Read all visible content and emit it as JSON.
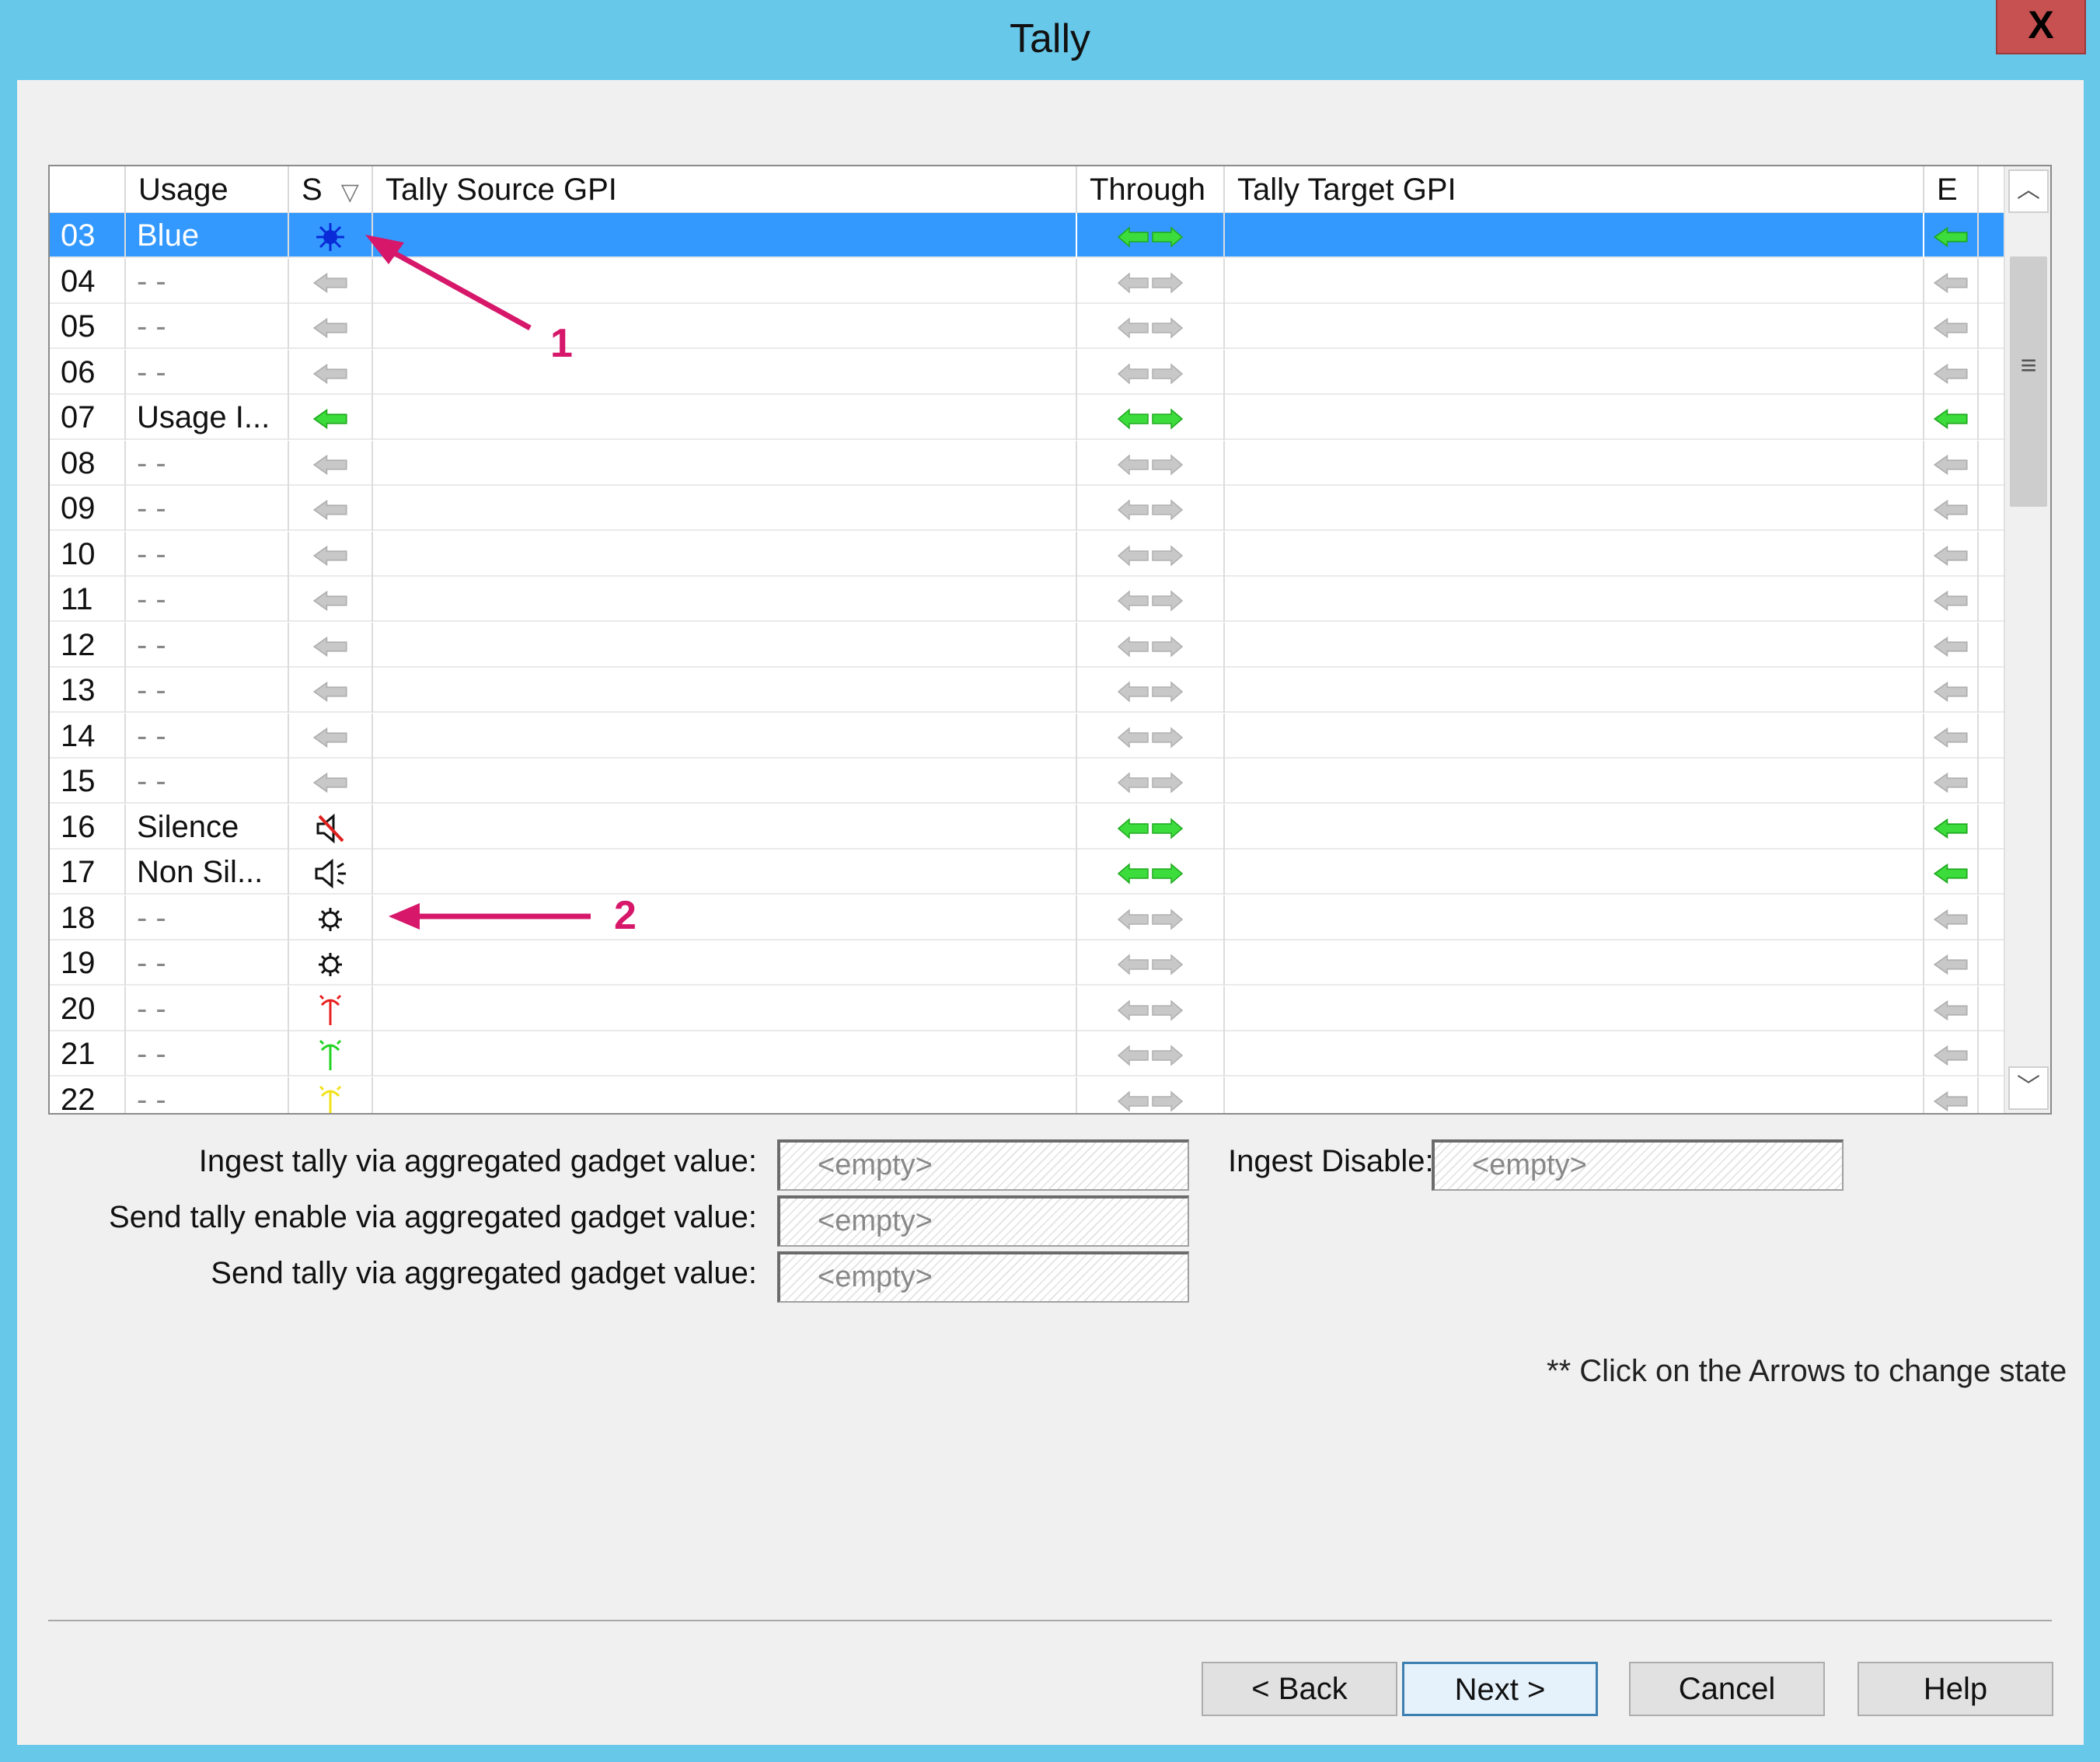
{
  "window": {
    "title": "Tally",
    "close_label": "X"
  },
  "grid": {
    "columns": {
      "usage": "Usage",
      "s": "S",
      "source": "Tally Source GPI",
      "through": "Through",
      "target": "Tally Target GPI",
      "e": "E"
    },
    "rows": [
      {
        "id": "03",
        "usage": "Blue",
        "s_icon": "blue-star-icon",
        "through": "active",
        "e": "active",
        "selected": true
      },
      {
        "id": "04",
        "usage": "- -",
        "s_icon": "arrow-left-inactive-icon",
        "through": "inactive",
        "e": "inactive"
      },
      {
        "id": "05",
        "usage": "- -",
        "s_icon": "arrow-left-inactive-icon",
        "through": "inactive",
        "e": "inactive"
      },
      {
        "id": "06",
        "usage": "- -",
        "s_icon": "arrow-left-inactive-icon",
        "through": "inactive",
        "e": "inactive"
      },
      {
        "id": "07",
        "usage": "Usage I...",
        "s_icon": "arrow-left-active-icon",
        "through": "active",
        "e": "active"
      },
      {
        "id": "08",
        "usage": "- -",
        "s_icon": "arrow-left-inactive-icon",
        "through": "inactive",
        "e": "inactive"
      },
      {
        "id": "09",
        "usage": "- -",
        "s_icon": "arrow-left-inactive-icon",
        "through": "inactive",
        "e": "inactive"
      },
      {
        "id": "10",
        "usage": "- -",
        "s_icon": "arrow-left-inactive-icon",
        "through": "inactive",
        "e": "inactive"
      },
      {
        "id": "11",
        "usage": "- -",
        "s_icon": "arrow-left-inactive-icon",
        "through": "inactive",
        "e": "inactive"
      },
      {
        "id": "12",
        "usage": "- -",
        "s_icon": "arrow-left-inactive-icon",
        "through": "inactive",
        "e": "inactive"
      },
      {
        "id": "13",
        "usage": "- -",
        "s_icon": "arrow-left-inactive-icon",
        "through": "inactive",
        "e": "inactive"
      },
      {
        "id": "14",
        "usage": "- -",
        "s_icon": "arrow-left-inactive-icon",
        "through": "inactive",
        "e": "inactive"
      },
      {
        "id": "15",
        "usage": "- -",
        "s_icon": "arrow-left-inactive-icon",
        "through": "inactive",
        "e": "inactive"
      },
      {
        "id": "16",
        "usage": "Silence",
        "s_icon": "speaker-muted-icon",
        "through": "active",
        "e": "active"
      },
      {
        "id": "17",
        "usage": "Non Sil...",
        "s_icon": "speaker-sound-icon",
        "through": "active",
        "e": "active"
      },
      {
        "id": "18",
        "usage": "- -",
        "s_icon": "gear-bulb-icon",
        "through": "inactive",
        "e": "inactive"
      },
      {
        "id": "19",
        "usage": "- -",
        "s_icon": "gear-bulb-icon",
        "through": "inactive",
        "e": "inactive"
      },
      {
        "id": "20",
        "usage": "- -",
        "s_icon": "red-antenna-icon",
        "through": "inactive",
        "e": "inactive"
      },
      {
        "id": "21",
        "usage": "- -",
        "s_icon": "green-antenna-icon",
        "through": "inactive",
        "e": "inactive"
      },
      {
        "id": "22",
        "usage": "- -",
        "s_icon": "yellow-antenna-icon",
        "through": "inactive",
        "e": "inactive"
      }
    ]
  },
  "annotations": {
    "label_1": "1",
    "label_2": "2"
  },
  "fields": {
    "ingest_label": "Ingest tally via aggregated gadget value:",
    "ingest_value": "<empty>",
    "send_enable_label": "Send tally enable via aggregated gadget value:",
    "send_enable_value": "<empty>",
    "send_label": "Send tally via aggregated gadget value:",
    "send_value": "<empty>",
    "ingest_disable_label": "Ingest Disable:",
    "ingest_disable_value": "<empty>"
  },
  "note": "** Click on the Arrows to change state",
  "buttons": {
    "back": "< Back",
    "next": "Next >",
    "cancel": "Cancel",
    "help": "Help"
  },
  "colors": {
    "titlebar": "#67c8ea",
    "selection": "#3399ff",
    "arrow_active": "#3ddc3d",
    "arrow_inactive": "#c8c8c8",
    "annotation": "#d6176a"
  }
}
